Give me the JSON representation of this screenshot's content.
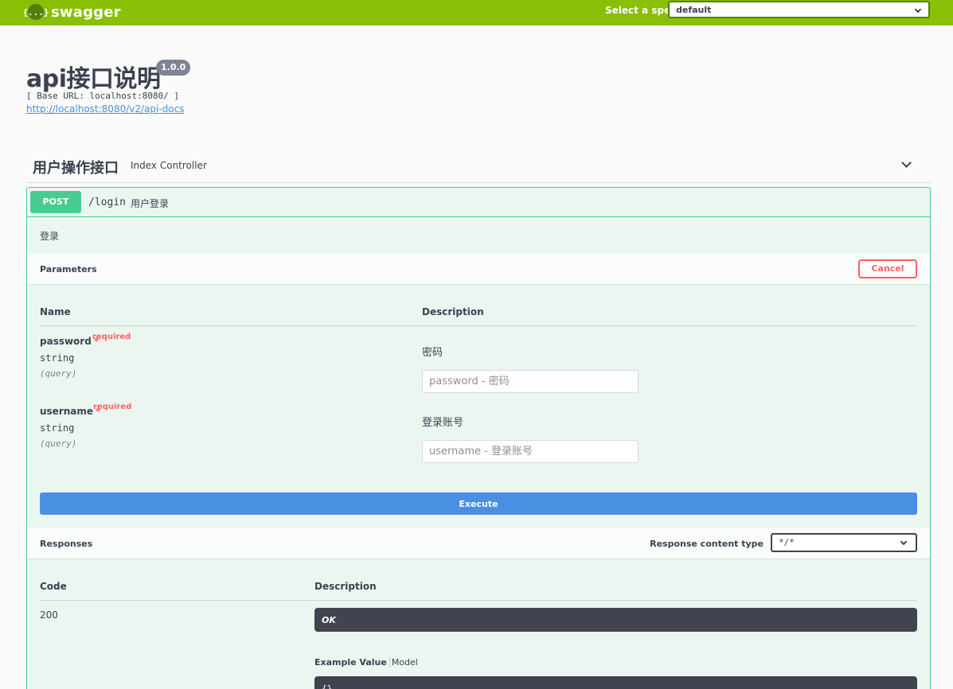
{
  "topbar": {
    "logo_mark": "{...}",
    "logo_text": "swagger",
    "spec_label": "Select a spec",
    "spec_value": "default"
  },
  "info": {
    "title": "api接口说明",
    "version": "1.0.0",
    "base_url": "[ Base URL: localhost:8080/ ]",
    "docs_url": "http://localhost:8080/v2/api-docs"
  },
  "tag": {
    "name": "用户操作接口",
    "description": "Index Controller"
  },
  "operation": {
    "method": "POST",
    "path": "/login",
    "summary": "用户登录",
    "description": "登录",
    "colors": {
      "post": "#49cc90",
      "execute": "#4990e2",
      "cancel": "#ff6060",
      "topbar": "#89bf04"
    },
    "parameters_title": "Parameters",
    "cancel_label": "Cancel",
    "col_name": "Name",
    "col_description": "Description",
    "params": [
      {
        "name": "password",
        "required_star": "*",
        "required_label": "required",
        "type": "string",
        "in": "(query)",
        "description": "密码",
        "placeholder": "password - 密码"
      },
      {
        "name": "username",
        "required_star": "*",
        "required_label": "required",
        "type": "string",
        "in": "(query)",
        "description": "登录账号",
        "placeholder": "username - 登录账号"
      }
    ],
    "execute_label": "Execute",
    "responses_title": "Responses",
    "response_content_type_label": "Response content type",
    "response_content_type_value": "*/*",
    "resp_col_code": "Code",
    "resp_col_description": "Description",
    "responses": [
      {
        "code": "200",
        "description": "OK"
      }
    ],
    "example_value_tab": "Example Value",
    "model_tab": "Model",
    "example_value": "{}"
  }
}
